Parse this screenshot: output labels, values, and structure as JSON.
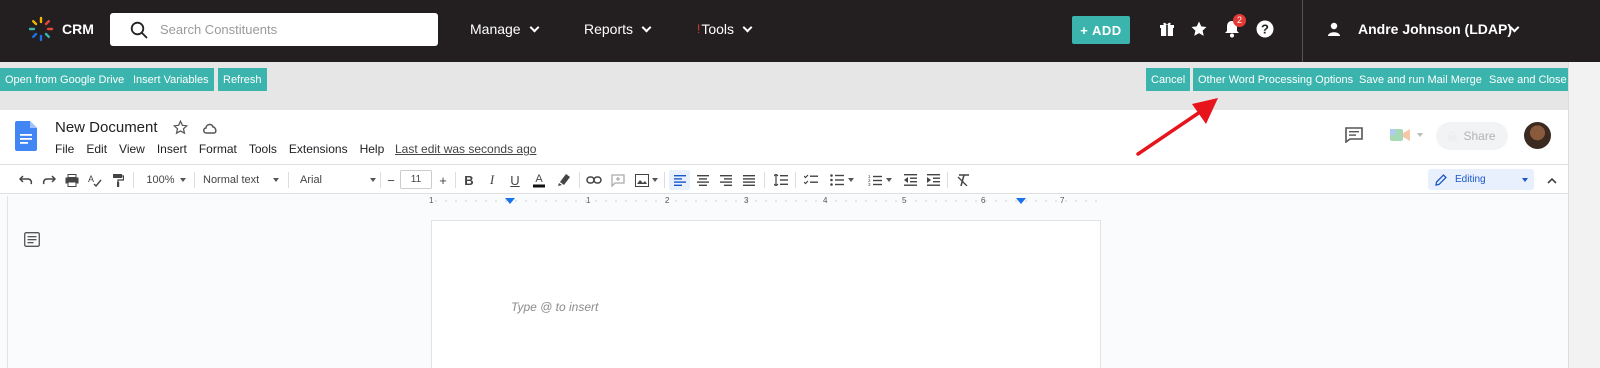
{
  "crm": {
    "brand": "CRM",
    "search": {
      "placeholder": "Search Constituents",
      "value": ""
    },
    "nav": [
      {
        "label": "Manage"
      },
      {
        "label": "Reports"
      },
      {
        "label": "Tools",
        "marker": "!"
      }
    ],
    "add_label": "+ ADD",
    "notifications_count": "2",
    "user_name": "Andre Johnson (LDAP)",
    "icons": [
      "gift-icon",
      "star-icon",
      "bell-icon",
      "help-icon",
      "user-icon"
    ]
  },
  "actions": {
    "open_drive": "Open from Google Drive",
    "insert_variables": "Insert Variables",
    "refresh": "Refresh",
    "cancel": "Cancel",
    "other_options": "Other Word Processing Options",
    "save_mail_merge": "Save and run Mail Merge",
    "save_close": "Save and Close"
  },
  "doc": {
    "title": "New Document",
    "menu": [
      "File",
      "Edit",
      "View",
      "Insert",
      "Format",
      "Tools",
      "Extensions",
      "Help"
    ],
    "last_edit": "Last edit was seconds ago",
    "share_label": "Share"
  },
  "toolbar": {
    "zoom": "100%",
    "style": "Normal text",
    "font": "Arial",
    "font_size": "11",
    "mode": "Editing"
  },
  "ruler": {
    "labels": [
      "1",
      "1",
      "2",
      "3",
      "4",
      "5",
      "6",
      "7"
    ]
  },
  "canvas": {
    "placeholder": "Type @ to insert"
  },
  "colors": {
    "topbar": "#231f20",
    "accent": "#3ab4ad",
    "badge": "#e53935",
    "arrow": "#e8141c",
    "docs_blue": "#1a73e8"
  }
}
